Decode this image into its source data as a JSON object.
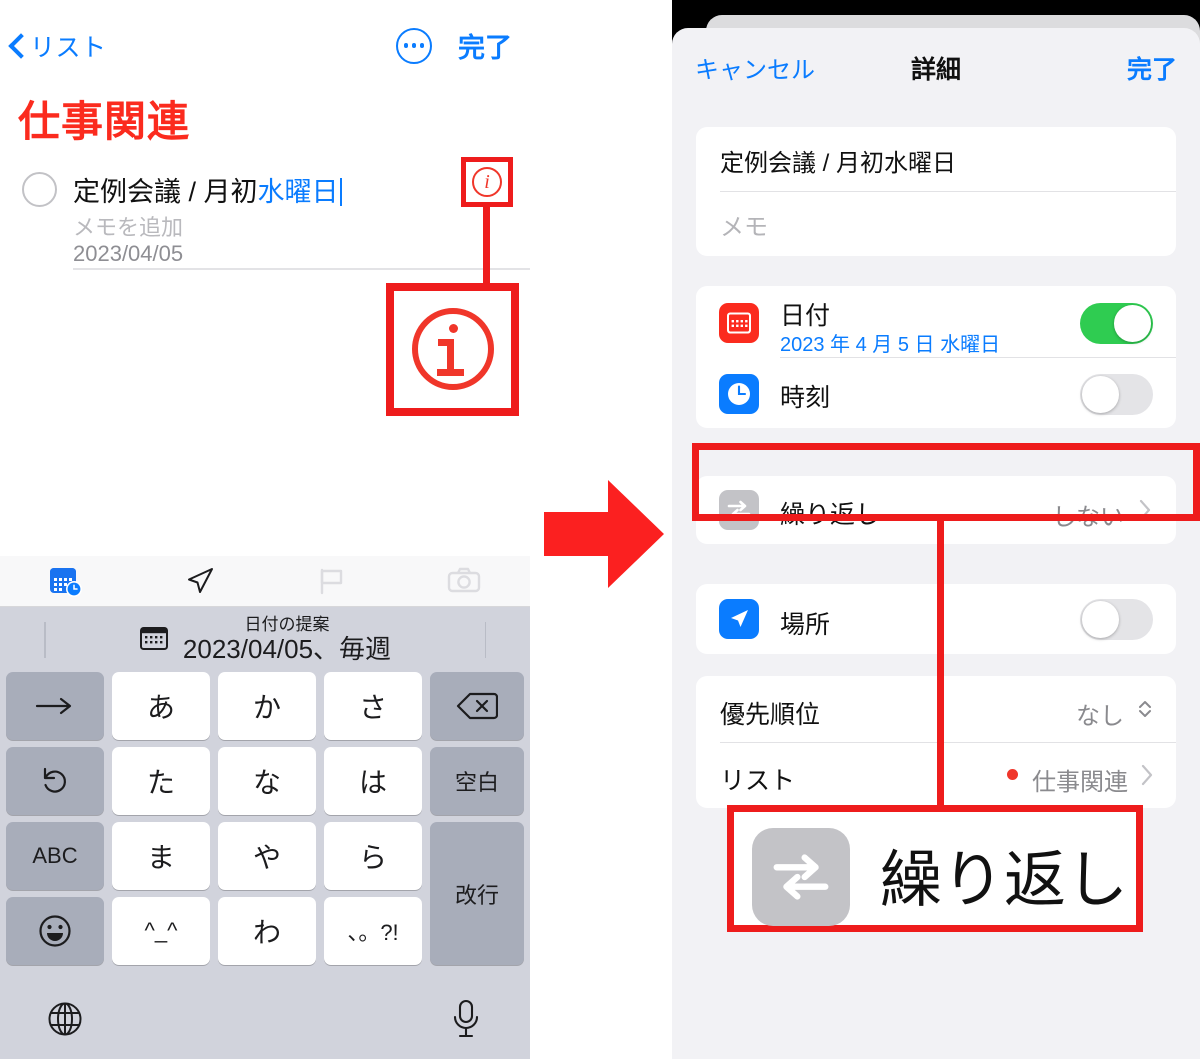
{
  "left_panel": {
    "nav": {
      "back_label": "リスト",
      "back_icon": "chevron-left-icon",
      "more_icon": "ellipsis-circle-icon",
      "done_label": "完了"
    },
    "list_title": "仕事関連",
    "task": {
      "title_plain": "定例会議 / 月初",
      "title_highlight": "水曜日",
      "note_placeholder": "メモを追加",
      "date": "2023/04/05",
      "checkbox_icon": "circle-unchecked-icon",
      "info_icon": "info-circle-icon"
    },
    "keyboard": {
      "toolbar_icons": [
        "calendar-clock-icon",
        "navigation-arrow-icon",
        "flag-icon",
        "camera-icon"
      ],
      "suggestion": {
        "icon": "calendar-icon",
        "label": "日付の提案",
        "value": "2023/04/05、毎週"
      },
      "rows": [
        [
          {
            "label": "→",
            "type": "grey",
            "name": "key-arrow-right"
          },
          {
            "label": "あ",
            "type": "white",
            "name": "key-a"
          },
          {
            "label": "か",
            "type": "white",
            "name": "key-ka"
          },
          {
            "label": "さ",
            "type": "white",
            "name": "key-sa"
          },
          {
            "label": "⌫",
            "type": "grey",
            "name": "key-backspace"
          }
        ],
        [
          {
            "label": "↺",
            "type": "grey",
            "name": "key-undo"
          },
          {
            "label": "た",
            "type": "white",
            "name": "key-ta"
          },
          {
            "label": "な",
            "type": "white",
            "name": "key-na"
          },
          {
            "label": "は",
            "type": "white",
            "name": "key-ha"
          },
          {
            "label": "空白",
            "type": "grey",
            "name": "key-space"
          }
        ],
        [
          {
            "label": "ABC",
            "type": "grey",
            "name": "key-abc"
          },
          {
            "label": "ま",
            "type": "white",
            "name": "key-ma"
          },
          {
            "label": "や",
            "type": "white",
            "name": "key-ya"
          },
          {
            "label": "ら",
            "type": "white",
            "name": "key-ra"
          },
          {
            "label": "改行",
            "type": "grey",
            "name": "key-return"
          }
        ],
        [
          {
            "label": "☺",
            "type": "grey",
            "name": "key-emoji"
          },
          {
            "label": "^_^",
            "type": "white",
            "name": "key-kaomoji"
          },
          {
            "label": "わ",
            "type": "white",
            "name": "key-wa"
          },
          {
            "label": "、。?!",
            "type": "white",
            "name": "key-punct"
          }
        ]
      ],
      "bottom_icons": [
        "globe-icon",
        "microphone-icon"
      ]
    }
  },
  "arrow": {
    "icon": "right-arrow-icon",
    "color": "#fb2020"
  },
  "right_panel": {
    "nav": {
      "cancel_label": "キャンセル",
      "title": "詳細",
      "done_label": "完了"
    },
    "title_field": {
      "value": "定例会議 / 月初水曜日",
      "note_placeholder": "メモ"
    },
    "date_row": {
      "icon": "calendar-icon",
      "icon_color": "#fb2b1e",
      "label": "日付",
      "sub": "2023 年 4 月 5 日 水曜日",
      "toggle_state": "on"
    },
    "time_row": {
      "icon": "clock-icon",
      "icon_color": "#0a7cff",
      "label": "時刻",
      "toggle_state": "off"
    },
    "repeat_row": {
      "icon": "repeat-icon",
      "label": "繰り返し",
      "value": "しない",
      "chevron": "chevron-right-icon"
    },
    "location_row": {
      "icon": "navigation-arrow-icon",
      "icon_color": "#0a7cff",
      "label": "場所",
      "toggle_state": "off"
    },
    "priority_row": {
      "label": "優先順位",
      "value": "なし",
      "stepper": "chevron-updown-icon"
    },
    "list_row": {
      "label": "リスト",
      "value": "仕事関連",
      "dot_color": "#f0362a",
      "chevron": "chevron-right-icon"
    },
    "callout": {
      "icon": "repeat-icon",
      "label": "繰り返し",
      "highlight_color": "#ee1c1c"
    }
  }
}
